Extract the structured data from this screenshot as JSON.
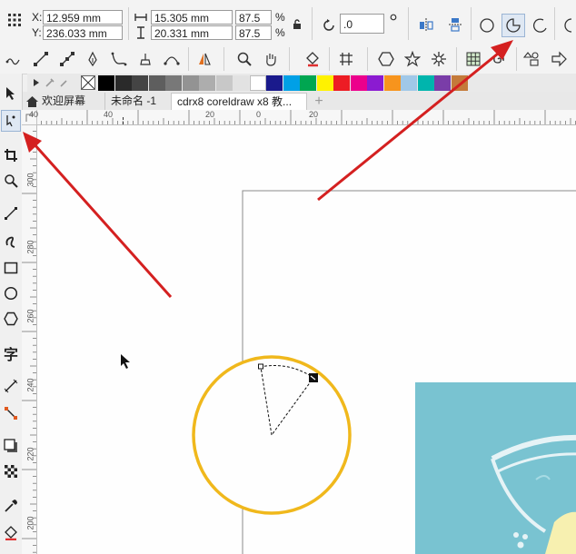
{
  "propbar": {
    "x_label": "X:",
    "x_value": "12.959 mm",
    "y_label": "Y:",
    "y_value": "236.033 mm",
    "w_value": "15.305 mm",
    "h_value": "20.331 mm",
    "scale_x": "87.5",
    "scale_y": "87.5",
    "percent_1": "%",
    "percent_2": "%",
    "rotation": ".0"
  },
  "tabs": [
    {
      "label": "欢迎屏幕"
    },
    {
      "label": "未命名 -1"
    },
    {
      "label": "cdrx8 coreldraw x8 教..."
    }
  ],
  "tab_add": "+",
  "toolbox": {
    "text_tool_glyph": "字"
  },
  "rulers": {
    "h_ticks": [
      "40",
      "40",
      "20",
      "0",
      "20"
    ],
    "v_ticks": [
      "300",
      "280",
      "260",
      "240",
      "220",
      "200"
    ]
  },
  "palette": {
    "colors": [
      "#000000",
      "#2a2a2a",
      "#444444",
      "#5e5e5e",
      "#787878",
      "#939393",
      "#adadad",
      "#c8c8c8",
      "#e2e2e2",
      "#ffffff",
      "#1a1a8c",
      "#00a0e6",
      "#00a651",
      "#fff200",
      "#ed1c24",
      "#ec008c",
      "#8b1bd1",
      "#f7941d",
      "#a0c8e8",
      "#00b5ad",
      "#7a3da8",
      "#c47a3a"
    ]
  },
  "accent": {
    "circle_stroke": "#f0b81c",
    "arrow": "#d42020",
    "image_bg": "#79c3d1"
  }
}
